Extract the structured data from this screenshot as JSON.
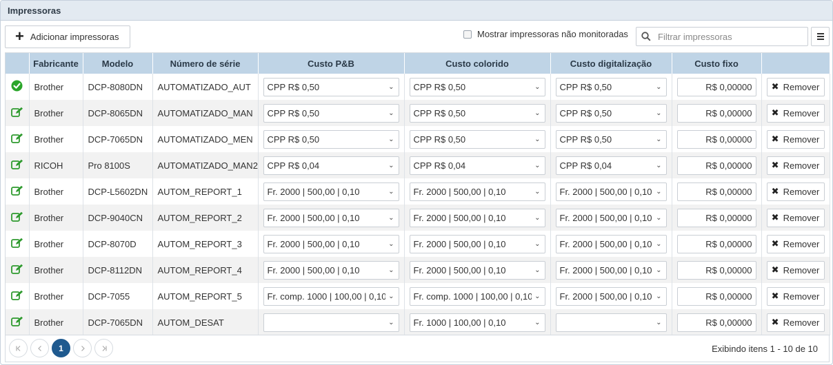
{
  "panel": {
    "title": "Impressoras"
  },
  "toolbar": {
    "add_label": "Adicionar impressoras",
    "show_unmonitored_label": "Mostrar impressoras não monitoradas",
    "filter_placeholder": "Filtrar impressoras"
  },
  "table": {
    "headers": [
      "",
      "Fabricante",
      "Modelo",
      "Número de série",
      "Custo P&B",
      "Custo colorido",
      "Custo digitalização",
      "Custo fixo",
      ""
    ],
    "remove_label": "Remover",
    "rows": [
      {
        "status": "ok",
        "fabricante": "Brother",
        "modelo": "DCP-8080DN",
        "serie": "AUTOMATIZADO_AUT",
        "pb": "CPP R$ 0,50",
        "colorido": "CPP R$ 0,50",
        "digitalizacao": "CPP R$ 0,50",
        "fixo": "R$ 0,00000"
      },
      {
        "status": "edit",
        "fabricante": "Brother",
        "modelo": "DCP-8065DN",
        "serie": "AUTOMATIZADO_MAN",
        "pb": "CPP R$ 0,50",
        "colorido": "CPP R$ 0,50",
        "digitalizacao": "CPP R$ 0,50",
        "fixo": "R$ 0,00000"
      },
      {
        "status": "edit",
        "fabricante": "Brother",
        "modelo": "DCP-7065DN",
        "serie": "AUTOMATIZADO_MEN",
        "pb": "CPP R$ 0,50",
        "colorido": "CPP R$ 0,50",
        "digitalizacao": "CPP R$ 0,50",
        "fixo": "R$ 0,00000"
      },
      {
        "status": "edit",
        "fabricante": "RICOH",
        "modelo": "Pro 8100S",
        "serie": "AUTOMATIZADO_MAN2",
        "pb": "CPP R$ 0,04",
        "colorido": "CPP R$ 0,04",
        "digitalizacao": "CPP R$ 0,04",
        "fixo": "R$ 0,00000"
      },
      {
        "status": "edit",
        "fabricante": "Brother",
        "modelo": "DCP-L5602DN",
        "serie": "AUTOM_REPORT_1",
        "pb": "Fr. 2000 | 500,00 | 0,10",
        "colorido": "Fr. 2000 | 500,00 | 0,10",
        "digitalizacao": "Fr. 2000 | 500,00 | 0,10",
        "fixo": "R$ 0,00000"
      },
      {
        "status": "edit",
        "fabricante": "Brother",
        "modelo": "DCP-9040CN",
        "serie": "AUTOM_REPORT_2",
        "pb": "Fr. 2000 | 500,00 | 0,10",
        "colorido": "Fr. 2000 | 500,00 | 0,10",
        "digitalizacao": "Fr. 2000 | 500,00 | 0,10",
        "fixo": "R$ 0,00000"
      },
      {
        "status": "edit",
        "fabricante": "Brother",
        "modelo": "DCP-8070D",
        "serie": "AUTOM_REPORT_3",
        "pb": "Fr. 2000 | 500,00 | 0,10",
        "colorido": "Fr. 2000 | 500,00 | 0,10",
        "digitalizacao": "Fr. 2000 | 500,00 | 0,10",
        "fixo": "R$ 0,00000"
      },
      {
        "status": "edit",
        "fabricante": "Brother",
        "modelo": "DCP-8112DN",
        "serie": "AUTOM_REPORT_4",
        "pb": "Fr. 2000 | 500,00 | 0,10",
        "colorido": "Fr. 2000 | 500,00 | 0,10",
        "digitalizacao": "Fr. 2000 | 500,00 | 0,10",
        "fixo": "R$ 0,00000"
      },
      {
        "status": "edit",
        "fabricante": "Brother",
        "modelo": "DCP-7055",
        "serie": "AUTOM_REPORT_5",
        "pb": "Fr. comp. 1000 | 100,00 | 0,10",
        "colorido": "Fr. comp. 1000 | 100,00 | 0,10",
        "digitalizacao": "Fr. 2000 | 500,00 | 0,10",
        "fixo": "R$ 0,00000"
      },
      {
        "status": "edit",
        "fabricante": "Brother",
        "modelo": "DCP-7065DN",
        "serie": "AUTOM_DESAT",
        "pb": "",
        "colorido": "Fr. 1000 | 100,00 | 0,10",
        "digitalizacao": "",
        "fixo": "R$ 0,00000"
      }
    ]
  },
  "pagination": {
    "current_page": "1",
    "info": "Exibindo itens 1 - 10 de 10"
  },
  "colors": {
    "header_bg": "#bfd4e6",
    "ok": "#2aa52a",
    "edit": "#2e9a2e",
    "active_page": "#1f5a8f"
  }
}
